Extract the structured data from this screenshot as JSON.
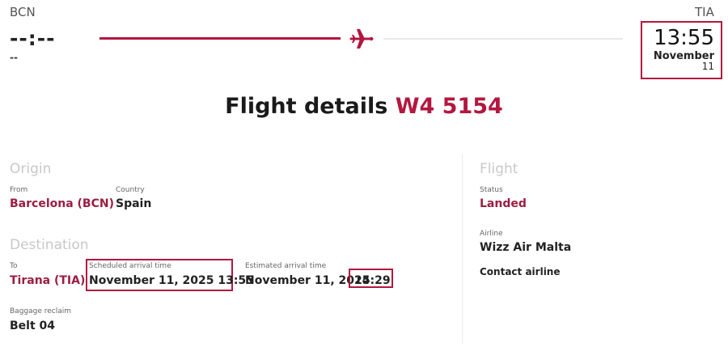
{
  "route": {
    "origin_code": "BCN",
    "destination_code": "TIA",
    "departure_time": "--:--",
    "departure_date": "--",
    "arrival_time": "13:55",
    "arrival_month": "November",
    "arrival_day": "11"
  },
  "heading": {
    "title": "Flight details",
    "flight_number": "W4 5154"
  },
  "origin": {
    "section_title": "Origin",
    "from_label": "From",
    "from_value": "Barcelona (BCN)",
    "country_label": "Country",
    "country_value": "Spain"
  },
  "destination": {
    "section_title": "Destination",
    "to_label": "To",
    "to_value": "Tirana (TIA)",
    "scheduled_label": "Scheduled arrival time",
    "scheduled_value": "November 11, 2025 13:55",
    "estimated_label": "Estimated arrival time",
    "estimated_date": "November 11, 2025",
    "estimated_time": "14:29",
    "baggage_label": "Baggage reclaim",
    "baggage_value": "Belt 04"
  },
  "flight": {
    "section_title": "Flight",
    "status_label": "Status",
    "status_value": "Landed",
    "airline_label": "Airline",
    "airline_value": "Wizz Air Malta",
    "contact_label": "Contact airline"
  },
  "colors": {
    "accent": "#b3173f",
    "muted_heading": "#c8c8c8"
  },
  "icons": {
    "plane": "airplane-icon"
  }
}
